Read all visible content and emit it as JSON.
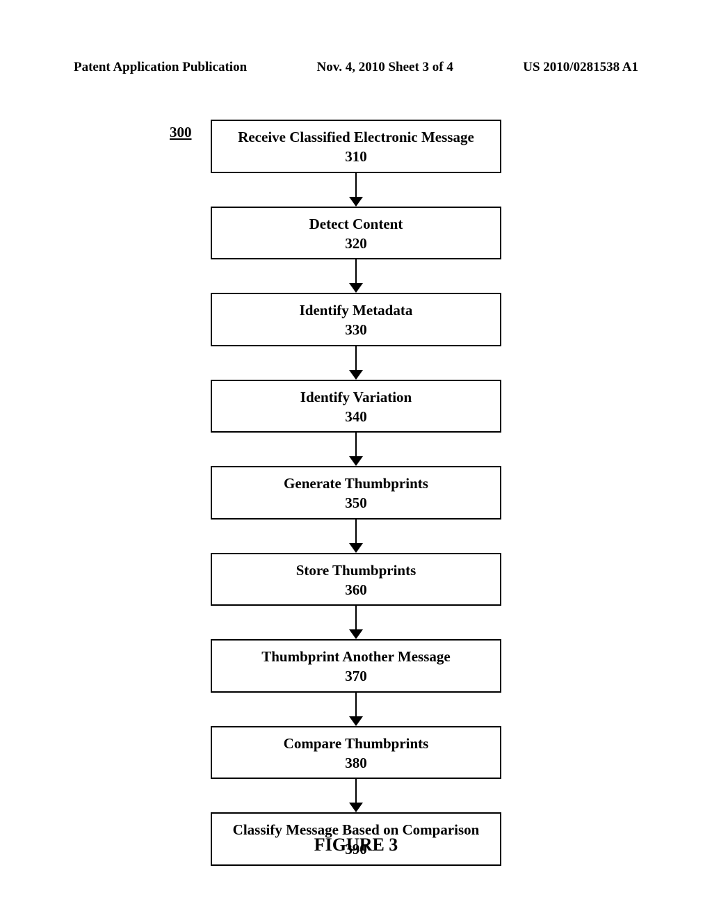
{
  "header": {
    "left": "Patent Application Publication",
    "center": "Nov. 4, 2010  Sheet 3 of 4",
    "right": "US 2010/0281538 A1"
  },
  "diagram": {
    "ref": "300",
    "steps": [
      {
        "title": "Receive Classified Electronic Message",
        "num": "310"
      },
      {
        "title": "Detect Content",
        "num": "320"
      },
      {
        "title": "Identify Metadata",
        "num": "330"
      },
      {
        "title": "Identify Variation",
        "num": "340"
      },
      {
        "title": "Generate Thumbprints",
        "num": "350"
      },
      {
        "title": "Store Thumbprints",
        "num": "360"
      },
      {
        "title": "Thumbprint Another Message",
        "num": "370"
      },
      {
        "title": "Compare Thumbprints",
        "num": "380"
      },
      {
        "title": "Classify Message Based on Comparison",
        "num": "390"
      }
    ],
    "caption": "FIGURE 3"
  }
}
